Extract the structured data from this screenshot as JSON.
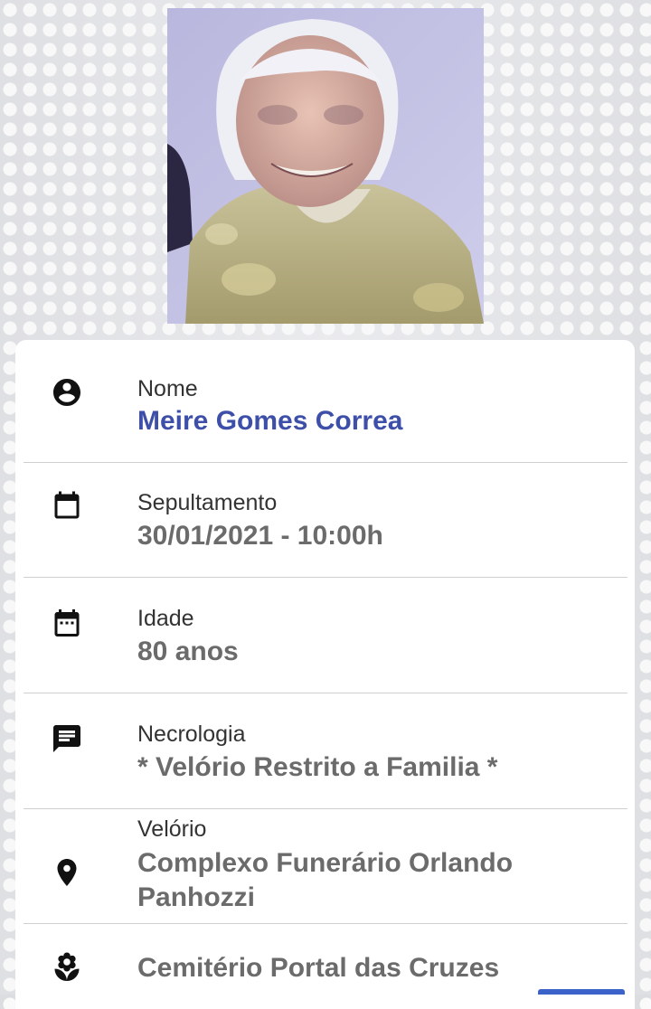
{
  "profile": {
    "photo_alt": "Foto do falecido"
  },
  "fields": [
    {
      "icon": "account-circle-icon",
      "label": "Nome",
      "value": "Meire Gomes Correa"
    },
    {
      "icon": "calendar-icon",
      "label": "Sepultamento",
      "value": "30/01/2021 - 10:00h"
    },
    {
      "icon": "calendar-dots-icon",
      "label": "Idade",
      "value": "80 anos"
    },
    {
      "icon": "message-icon",
      "label": "Necrologia",
      "value": "* Velório Restrito a Familia *"
    },
    {
      "icon": "location-pin-icon",
      "label": "Velório",
      "value": "Complexo Funerário Orlando Panhozzi"
    },
    {
      "icon": "flower-icon",
      "label": "",
      "value": "Cemitério Portal das Cruzes"
    }
  ],
  "colors": {
    "name_accent": "#3d4fa8",
    "value_gray": "#6b6b6b",
    "label_dark": "#333333"
  }
}
